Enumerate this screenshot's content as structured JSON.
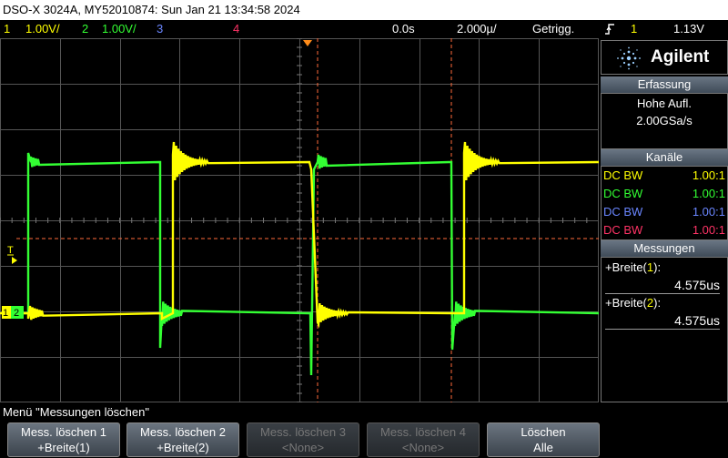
{
  "title_bar": "DSO-X 3024A, MY52010874: Sun Jan 21 13:34:58 2024",
  "status": {
    "ch1_num": "1",
    "ch1_scale": "1.00V/",
    "ch2_num": "2",
    "ch2_scale": "1.00V/",
    "ch3_num": "3",
    "ch4_num": "4",
    "time_delay": "0.0s",
    "time_scale": "2.000µ/",
    "trigger_mode": "Getrigg.",
    "trigger_source": "1",
    "trigger_level": "1.13V",
    "trigger_icon": "trigger-edge-icon"
  },
  "markers": {
    "trigger_level_marker": "T",
    "ch1_marker": "1",
    "ch2_marker": "2"
  },
  "brand": {
    "name": "Agilent",
    "logo_icon": "agilent-spark-icon"
  },
  "acquisition": {
    "header": "Erfassung",
    "mode": "Hohe Aufl.",
    "rate": "2.00GSa/s"
  },
  "channels": {
    "header": "Kanäle",
    "rows": [
      {
        "coupling": "DC BW",
        "probe": "1.00:1",
        "color": "#ffff00"
      },
      {
        "coupling": "DC BW",
        "probe": "1.00:1",
        "color": "#33ff33"
      },
      {
        "coupling": "DC BW",
        "probe": "1.00:1",
        "color": "#6a86ff"
      },
      {
        "coupling": "DC BW",
        "probe": "1.00:1",
        "color": "#ff3366"
      }
    ]
  },
  "measurements": {
    "header": "Messungen",
    "items": [
      {
        "prefix": "+Breite(",
        "ch": "1",
        "suffix": "):",
        "value": "4.575us"
      },
      {
        "prefix": "+Breite(",
        "ch": "2",
        "suffix": "):",
        "value": "4.575us"
      }
    ]
  },
  "menu_title": "Menü \"Messungen löschen\"",
  "softkeys": [
    {
      "line1": "Mess. löschen 1",
      "line2": "+Breite(1)",
      "enabled": true
    },
    {
      "line1": "Mess. löschen 2",
      "line2": "+Breite(2)",
      "enabled": true
    },
    {
      "line1": "Mess. löschen 3",
      "line2": "<None>",
      "enabled": false
    },
    {
      "line1": "Mess. löschen 4",
      "line2": "<None>",
      "enabled": false
    },
    {
      "line1": "Löschen",
      "line2": "Alle",
      "enabled": true
    }
  ],
  "colors": {
    "ch1": "#ffff00",
    "ch2": "#33ff33",
    "ch3": "#6a86ff",
    "ch4": "#ff3366",
    "grid": "#7a7a7a",
    "cursor": "#ff6a3a",
    "trigger_marker": "#ff8c1a",
    "title_bg": "#ffffff"
  }
}
